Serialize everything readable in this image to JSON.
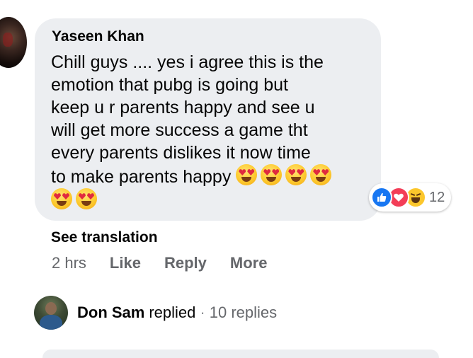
{
  "comment": {
    "author": "Yaseen Khan",
    "text_lines": [
      "Chill guys .... yes i agree this is the",
      "emotion that pubg is going but",
      "keep u r parents happy and see u",
      "will get more success a game tht",
      "every parents dislikes it now time",
      "to make parents happy"
    ],
    "emojis": [
      "heart-eyes-emoji",
      "heart-eyes-emoji",
      "heart-eyes-emoji",
      "heart-eyes-emoji",
      "heart-eyes-emoji",
      "heart-eyes-emoji"
    ],
    "reactions": {
      "icons": [
        "like-reaction-icon",
        "love-reaction-icon",
        "haha-reaction-icon"
      ],
      "count": "12"
    },
    "see_translation": "See translation",
    "time": "2 hrs",
    "actions": {
      "like": "Like",
      "reply": "Reply",
      "more": "More"
    }
  },
  "replies": {
    "replier": "Don Sam",
    "replied_label": "replied",
    "separator": "·",
    "count_label": "10 replies"
  },
  "colors": {
    "bubble_bg": "#eceef1",
    "secondary_text": "#65676b",
    "like_blue": "#1877f2",
    "love_red": "#f33e58",
    "haha_yellow": "#fcc72c"
  }
}
